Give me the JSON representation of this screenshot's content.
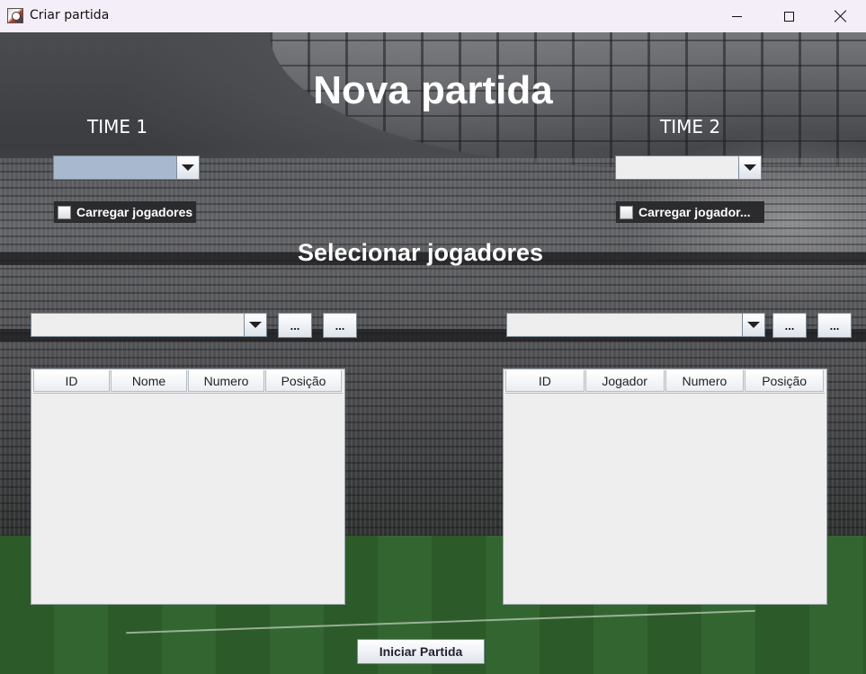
{
  "window": {
    "title": "Criar partida",
    "app_icon": "soccer-ball-app-icon"
  },
  "header": {
    "title": "Nova partida",
    "team1_label": "TIME 1",
    "team2_label": "TIME 2",
    "select_title": "Selecionar jogadores"
  },
  "team1": {
    "combo_value": "",
    "load_players_label": "Carregar jogadores",
    "load_players_checked": false,
    "players_combo_value": "",
    "btn_a_label": "...",
    "btn_b_label": "...",
    "table_columns": [
      "ID",
      "Nome",
      "Numero",
      "Posição"
    ],
    "table_rows": []
  },
  "team2": {
    "combo_value": "",
    "load_players_label": "Carregar jogador...",
    "load_players_checked": false,
    "players_combo_value": "",
    "btn_a_label": "...",
    "btn_b_label": "...",
    "table_columns": [
      "ID",
      "Jogador",
      "Numero",
      "Posição"
    ],
    "table_rows": []
  },
  "footer": {
    "start_label": "Iniciar Partida"
  },
  "colors": {
    "title_bar": "#f3eef7",
    "selected_combo": "#a8b9cf",
    "text_on_background": "#ffffff",
    "table_background": "#eeeeee"
  }
}
